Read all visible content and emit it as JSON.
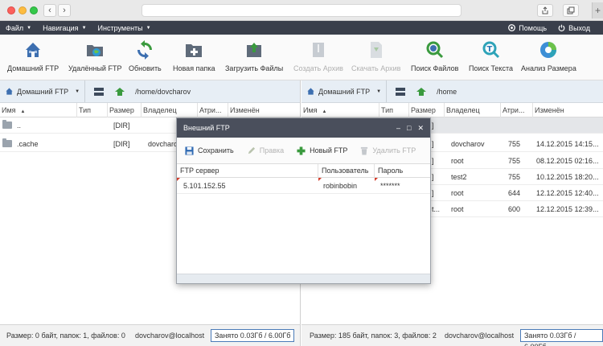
{
  "menubar": {
    "items": [
      {
        "label": "Файл"
      },
      {
        "label": "Навигация"
      },
      {
        "label": "Инструменты"
      }
    ],
    "help": "Помощь",
    "exit": "Выход"
  },
  "toolbar": {
    "home_ftp": "Домашний FTP",
    "remote_ftp": "Удалённый FTP",
    "refresh": "Обновить",
    "new_folder": "Новая папка",
    "upload": "Загрузить Файлы",
    "create_archive": "Создать Архив",
    "download_archive": "Скачать Архив",
    "search_files": "Поиск Файлов",
    "search_text": "Поиск Текста",
    "analyze_size": "Анализ Размера"
  },
  "left": {
    "location": "Домашний FTP",
    "path": "/home/dovcharov",
    "columns": {
      "name": "Имя",
      "type": "Тип",
      "size": "Размер",
      "owner": "Владелец",
      "attrs": "Атри...",
      "modified": "Изменён"
    },
    "rows": [
      {
        "name": "..",
        "size": "[DIR]",
        "owner": ""
      },
      {
        "name": ".cache",
        "size": "[DIR]",
        "owner": "dovcharo"
      }
    ],
    "status": "Размер: 0 байт, папок: 1, файлов: 0",
    "user": "dovcharov@localhost",
    "quota": "Занято 0.03Гб / 6.00Гб"
  },
  "right": {
    "location": "Домашний FTP",
    "path": "/home",
    "columns": {
      "name": "Имя",
      "type": "Тип",
      "size": "Размер",
      "owner": "Владелец",
      "attrs": "Атри...",
      "modified": "Изменён"
    },
    "rows": [
      {
        "type": "]",
        "owner": "",
        "attrs": "",
        "modified": ""
      },
      {
        "type": "]",
        "owner": "dovcharov",
        "attrs": "755",
        "modified": "14.12.2015 14:15..."
      },
      {
        "type": "]",
        "owner": "root",
        "attrs": "755",
        "modified": "08.12.2015 02:16..."
      },
      {
        "type": "]",
        "owner": "test2",
        "attrs": "755",
        "modified": "10.12.2015 18:20..."
      },
      {
        "type": "]",
        "owner": "root",
        "attrs": "644",
        "modified": "12.12.2015 12:40..."
      },
      {
        "type": "t...",
        "owner": "root",
        "attrs": "600",
        "modified": "12.12.2015 12:39..."
      }
    ],
    "status": "Размер: 185 байт, папок: 3, файлов: 2",
    "user": "dovcharov@localhost",
    "quota": "Занято 0.03Гб / 6.00Гб"
  },
  "dialog": {
    "title": "Внешний FTP",
    "controls": {
      "min": "‒",
      "max": "□",
      "close": "✕"
    },
    "toolbar": {
      "save": "Сохранить",
      "edit": "Правка",
      "new_ftp": "Новый FTP",
      "delete_ftp": "Удалить FTP"
    },
    "columns": {
      "server": "FTP сервер",
      "user": "Пользователь",
      "password": "Пароль"
    },
    "rows": [
      {
        "server": "5.101.152.55",
        "user": "robinbobin",
        "password": "*******"
      }
    ]
  }
}
